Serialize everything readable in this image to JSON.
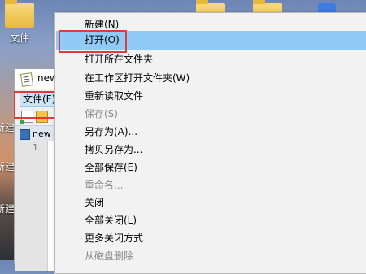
{
  "desktop": {
    "icon1_label": "文件",
    "side_label_1": "新建",
    "side_label_2": "新建",
    "side_label_3": "新建"
  },
  "notepadpp": {
    "title": "new",
    "menu_file": "文件(F)",
    "tab_label": "new 2",
    "line_number": "1"
  },
  "context_menu": {
    "items": [
      {
        "label": "新建(N)",
        "enabled": true
      },
      {
        "label": "打开(O)",
        "enabled": true,
        "selected": true
      },
      {
        "label": "打开所在文件夹",
        "enabled": true
      },
      {
        "label": "在工作区打开文件夹(W)",
        "enabled": true
      },
      {
        "label": "重新读取文件",
        "enabled": true
      },
      {
        "label": "保存(S)",
        "enabled": false
      },
      {
        "label": "另存为(A)...",
        "enabled": true
      },
      {
        "label": "拷贝另存为...",
        "enabled": true
      },
      {
        "label": "全部保存(E)",
        "enabled": true
      },
      {
        "label": "重命名...",
        "enabled": false
      },
      {
        "label": "关闭",
        "enabled": true
      },
      {
        "label": "全部关闭(L)",
        "enabled": true
      },
      {
        "label": "更多关闭方式",
        "enabled": true
      },
      {
        "label": "从磁盘删除",
        "enabled": false
      }
    ]
  },
  "colors": {
    "highlight": "#91c9f7",
    "annotation": "#e03a3a",
    "disabled_text": "#8a8a8a"
  }
}
